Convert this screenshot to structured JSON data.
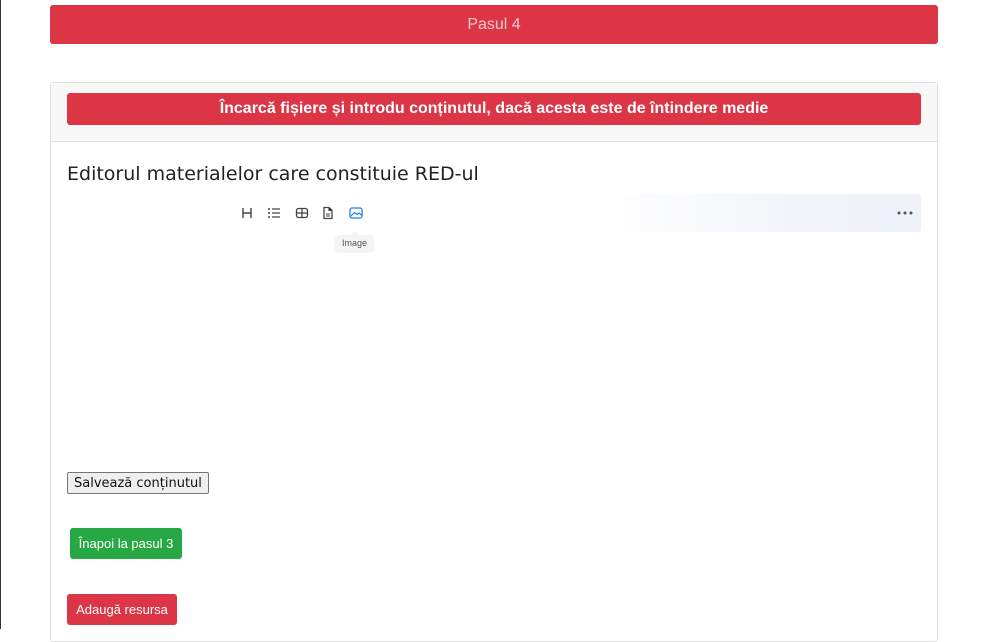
{
  "step_banner": {
    "label": "Pasul 4",
    "color": "#dc3545"
  },
  "card": {
    "header_title": "Încarcă fișiere și introdu conținutul, dacă acesta este de întindere medie"
  },
  "editor": {
    "title": "Editorul materialelor care constituie RED-ul",
    "toolbar": {
      "icons": [
        "heading-icon",
        "list-icon",
        "table-icon",
        "file-icon",
        "image-icon",
        "more-icon"
      ],
      "tooltip": "Image"
    }
  },
  "buttons": {
    "save_label": "Salvează conținutul",
    "back_label": "Înapoi la pasul 3",
    "add_label": "Adaugă resursa"
  },
  "colors": {
    "danger": "#dc3545",
    "success": "#28a745",
    "active_icon": "#2b7de9"
  }
}
